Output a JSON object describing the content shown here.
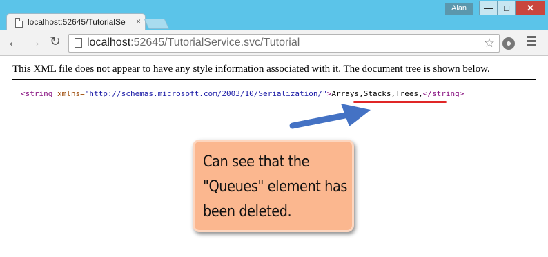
{
  "window": {
    "tab_title": "localhost:52645/TutorialSe",
    "tab_close": "×",
    "user": "Alan",
    "minimize": "—",
    "maximize": "□",
    "close": "✕"
  },
  "toolbar": {
    "back": "←",
    "forward": "→",
    "reload": "↻",
    "url_host": "localhost",
    "url_rest": ":52645/TutorialService.svc/Tutorial",
    "star": "☆"
  },
  "content": {
    "xml_notice": "This XML file does not appear to have any style information associated with it. The document tree is shown below.",
    "xml": {
      "open_tag_start": "<string",
      "attr_name": " xmlns=",
      "attr_value": "\"http://schemas.microsoft.com/2003/10/Serialization/\"",
      "open_tag_end": ">",
      "text": "Arrays,Stacks,Trees,",
      "close_tag": "</string>"
    },
    "callout": "Can see that the \"Queues\" element has been deleted."
  },
  "colors": {
    "titlebar": "#5bc4e9",
    "callout_fill": "#fbb78f",
    "arrow": "#4472c4",
    "underline": "#e02626"
  },
  "icons": [
    "page-icon",
    "star-icon",
    "extension-icon",
    "menu-icon",
    "arrow-icon"
  ]
}
